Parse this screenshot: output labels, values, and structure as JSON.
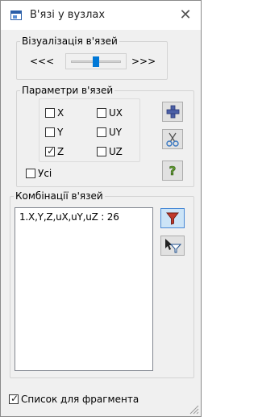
{
  "window": {
    "title": "В'язі у вузлах",
    "close_glyph": "✕"
  },
  "visualization": {
    "legend": "Візуалізація в'язей",
    "left_arrows": "<<<",
    "right_arrows": ">>>",
    "slider_level": 0.5
  },
  "parameters": {
    "legend": "Параметри в'язей",
    "checkboxes": [
      {
        "label": "X",
        "checked": false
      },
      {
        "label": "UX",
        "checked": false
      },
      {
        "label": "Y",
        "checked": false
      },
      {
        "label": "UY",
        "checked": false
      },
      {
        "label": "Z",
        "checked": true
      },
      {
        "label": "UZ",
        "checked": false
      }
    ],
    "all_label": "Усі",
    "all_checked": false
  },
  "combinations": {
    "legend": "Комбінації в'язей",
    "items": [
      "1.X,Y,Z,uX,uY,uZ  :  26"
    ]
  },
  "footer": {
    "fragment_label": "Список для фрагмента",
    "fragment_checked": true
  },
  "icons": {
    "add": "plus-icon",
    "remove": "scissors-icon",
    "help": "question-icon",
    "filter": "filter-icon",
    "pointer_filter": "pointer-filter-icon"
  },
  "colors": {
    "accent": "#2a5ea8",
    "plus": "#4b5fa6",
    "question": "#5f9a2e",
    "filter": "#c0392b"
  }
}
